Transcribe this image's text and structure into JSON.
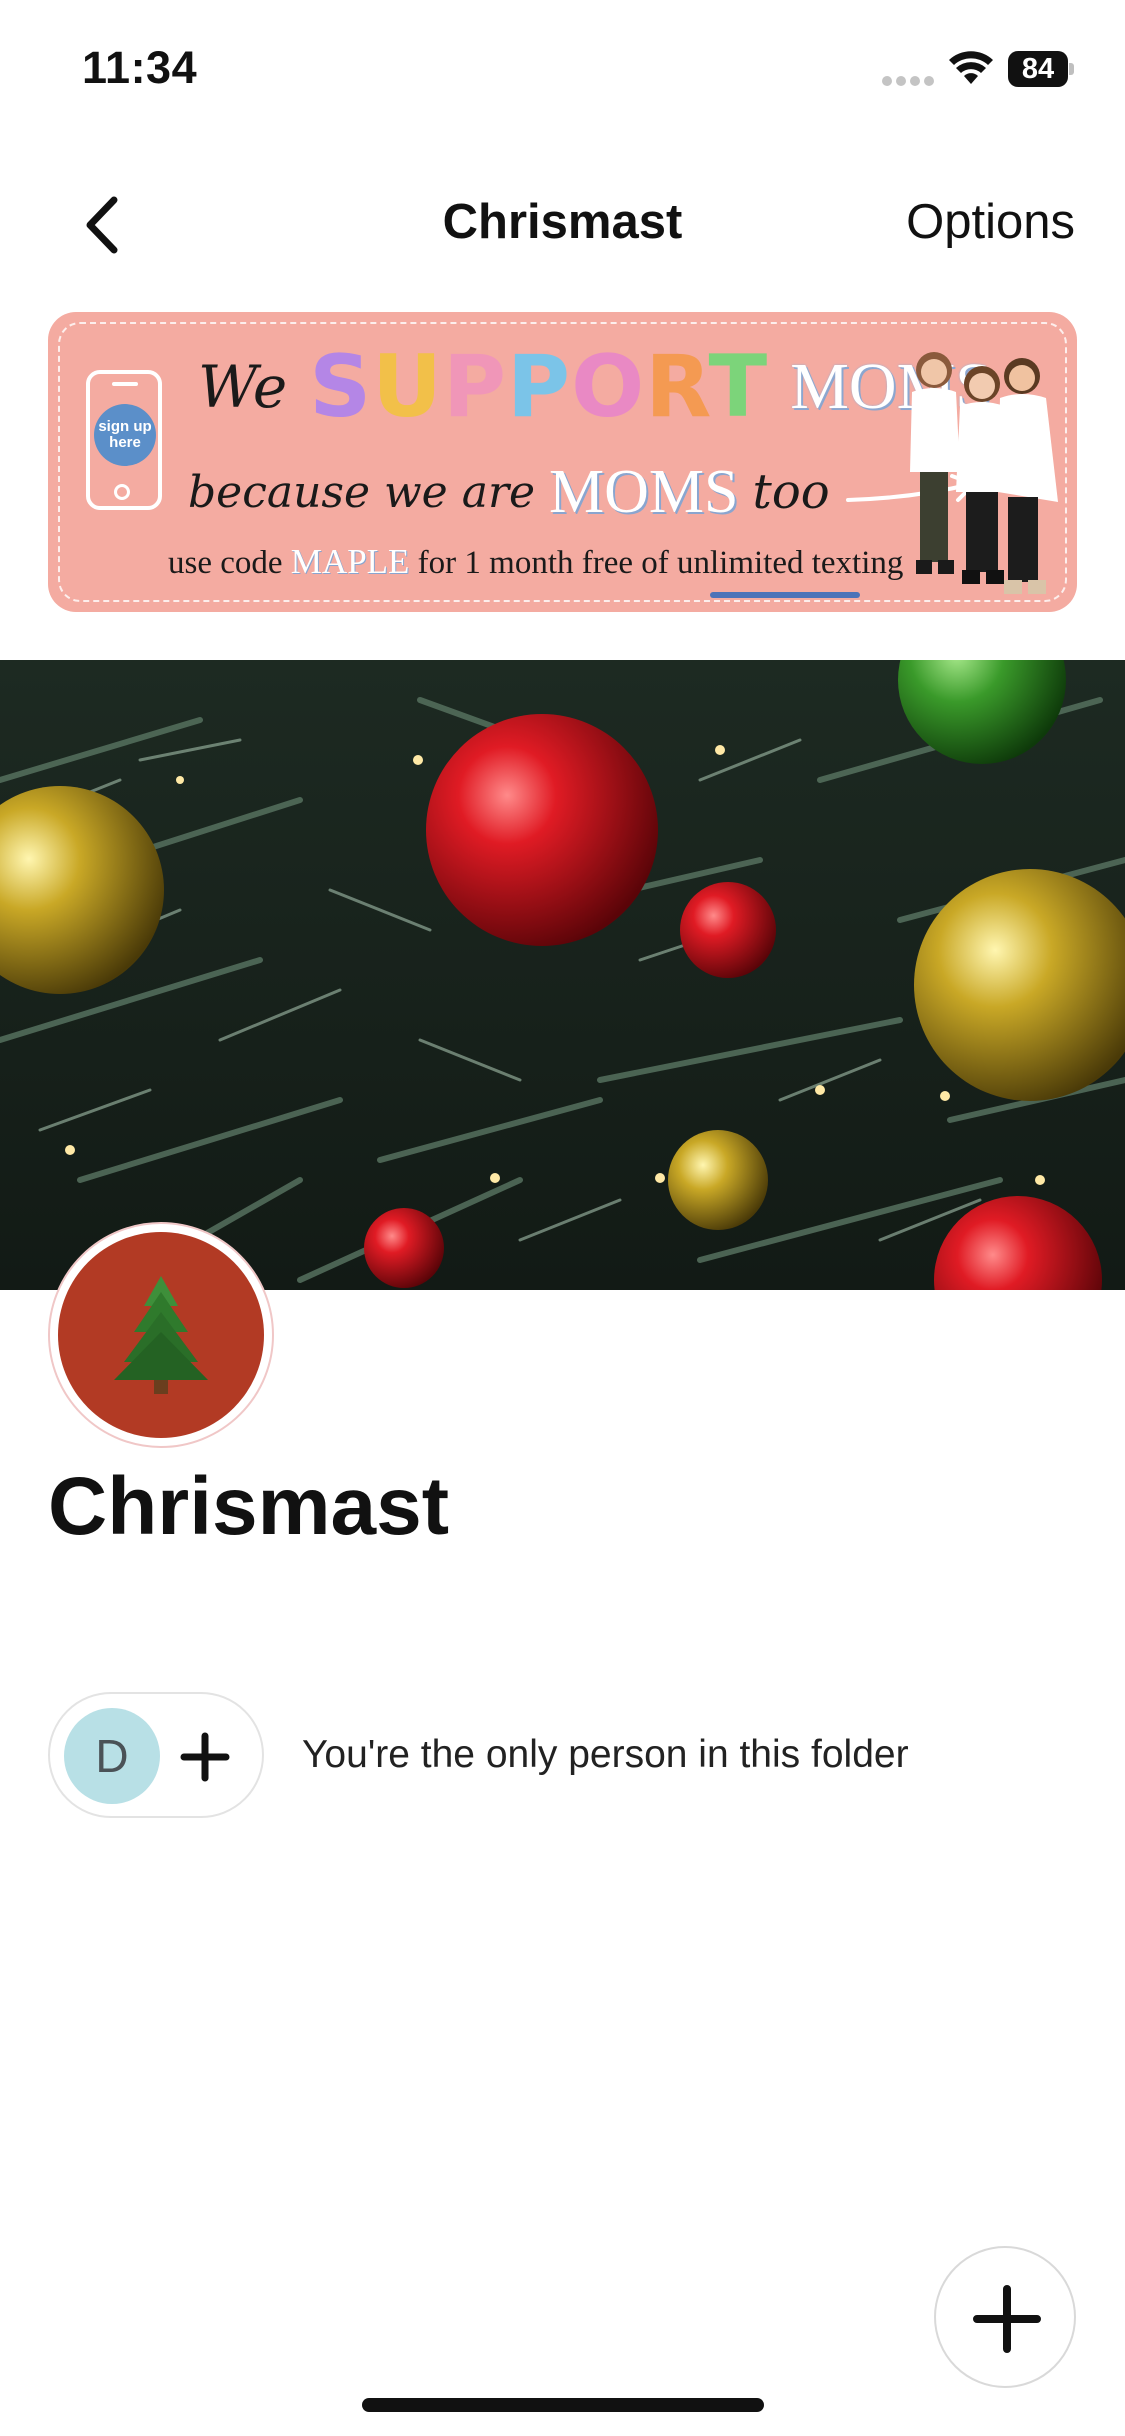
{
  "status_bar": {
    "time": "11:34",
    "battery": "84",
    "icons": [
      "signal-dots-icon",
      "wifi-icon",
      "battery-icon"
    ]
  },
  "nav": {
    "title": "Chrismast",
    "back_icon": "chevron-left-icon",
    "options_label": "Options"
  },
  "ad_banner": {
    "phone_badge": "sign up here",
    "line1_we": "We",
    "line1_support": [
      "S",
      "U",
      "P",
      "P",
      "O",
      "R",
      "T"
    ],
    "line1_moms": "MOMS",
    "line2_because": "because we are",
    "line2_moms": "MOMS",
    "line2_too": "too",
    "line3_prefix": "use code ",
    "line3_code": "MAPLE",
    "line3_suffix": " for 1 month free of unlimited texting",
    "colors": {
      "background": "#f4aba1",
      "badge": "#5b8fc9"
    }
  },
  "cover": {
    "image": "christmas-tree-ornaments-photo"
  },
  "folder": {
    "avatar_icon": "christmas-tree-icon",
    "avatar_color": "#b23a24",
    "title": "Chrismast"
  },
  "members": {
    "avatar_initial": "D",
    "avatar_color": "#b8e0e6",
    "add_icon": "plus-icon",
    "info_text": "You're the only person in this folder"
  },
  "fab": {
    "icon": "plus-icon"
  }
}
